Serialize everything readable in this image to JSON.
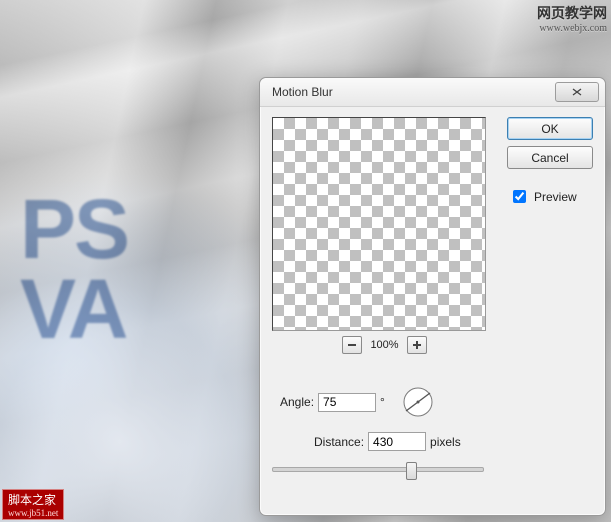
{
  "watermark_top": {
    "line1": "网页教学网",
    "line2": "www.webjx.com"
  },
  "watermark_bottom": {
    "line1": "脚本之家",
    "line2": "www.jb51.net"
  },
  "bg_text": {
    "line1": "PS",
    "line2": "VA"
  },
  "dialog": {
    "title": "Motion Blur",
    "ok_label": "OK",
    "cancel_label": "Cancel",
    "preview_label": "Preview",
    "preview_checked": true,
    "zoom": {
      "minus": "−",
      "plus": "+",
      "level": "100%"
    },
    "angle": {
      "label": "Angle:",
      "value": "75",
      "unit": "°"
    },
    "distance": {
      "label": "Distance:",
      "value": "430",
      "unit": "pixels"
    }
  }
}
